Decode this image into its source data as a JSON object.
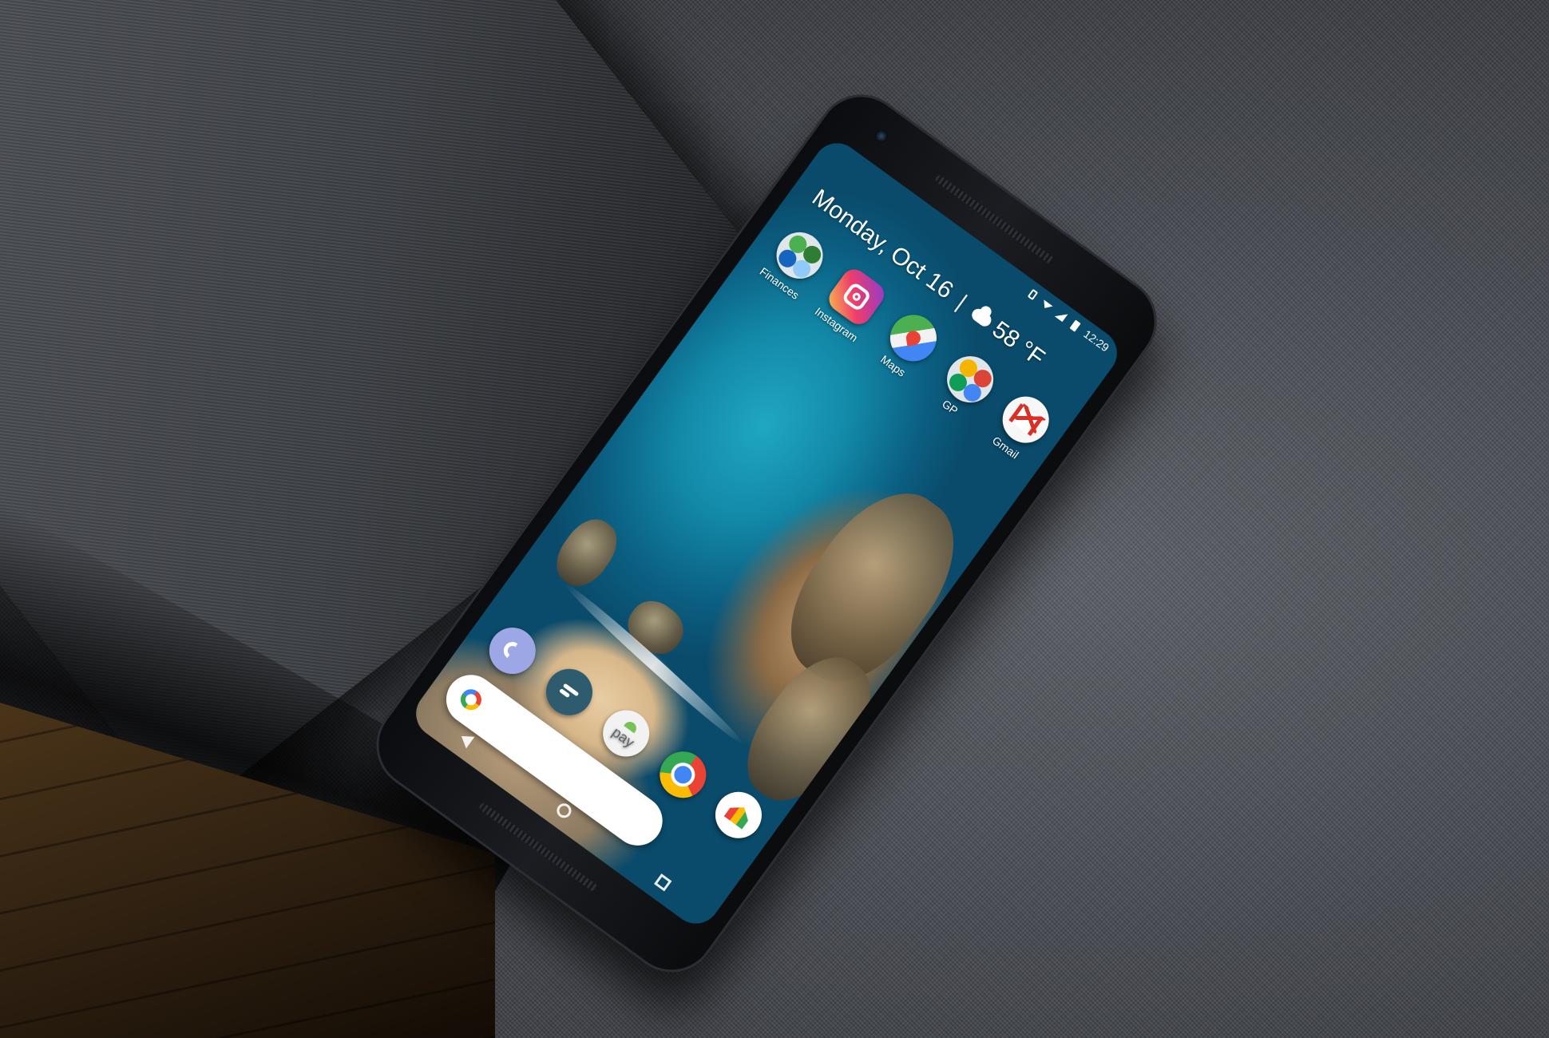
{
  "status_bar": {
    "time": "12:29",
    "icons": [
      "vibrate-icon",
      "wifi-icon",
      "signal-icon",
      "battery-icon"
    ]
  },
  "glance": {
    "date": "Monday, Oct 16",
    "separator": "|",
    "temperature": "58 °F",
    "weather_icon": "cloud-icon"
  },
  "apps": [
    {
      "label": "Finances",
      "icon": "folder-icon"
    },
    {
      "label": "Instagram",
      "icon": "instagram-icon"
    },
    {
      "label": "Maps",
      "icon": "maps-icon"
    },
    {
      "label": "GP",
      "icon": "folder-icon"
    },
    {
      "label": "Gmail",
      "icon": "gmail-icon"
    }
  ],
  "dock": [
    {
      "icon": "phone-icon"
    },
    {
      "icon": "messages-icon"
    },
    {
      "icon": "android-pay-icon",
      "text": "pay"
    },
    {
      "icon": "chrome-icon"
    },
    {
      "icon": "google-home-icon"
    }
  ],
  "search": {
    "icon": "google-g-icon"
  },
  "colors": {
    "ocean": "#1389a8",
    "sand": "#d7b78a",
    "phone_body": "#16181c",
    "fabric": "#464950"
  }
}
